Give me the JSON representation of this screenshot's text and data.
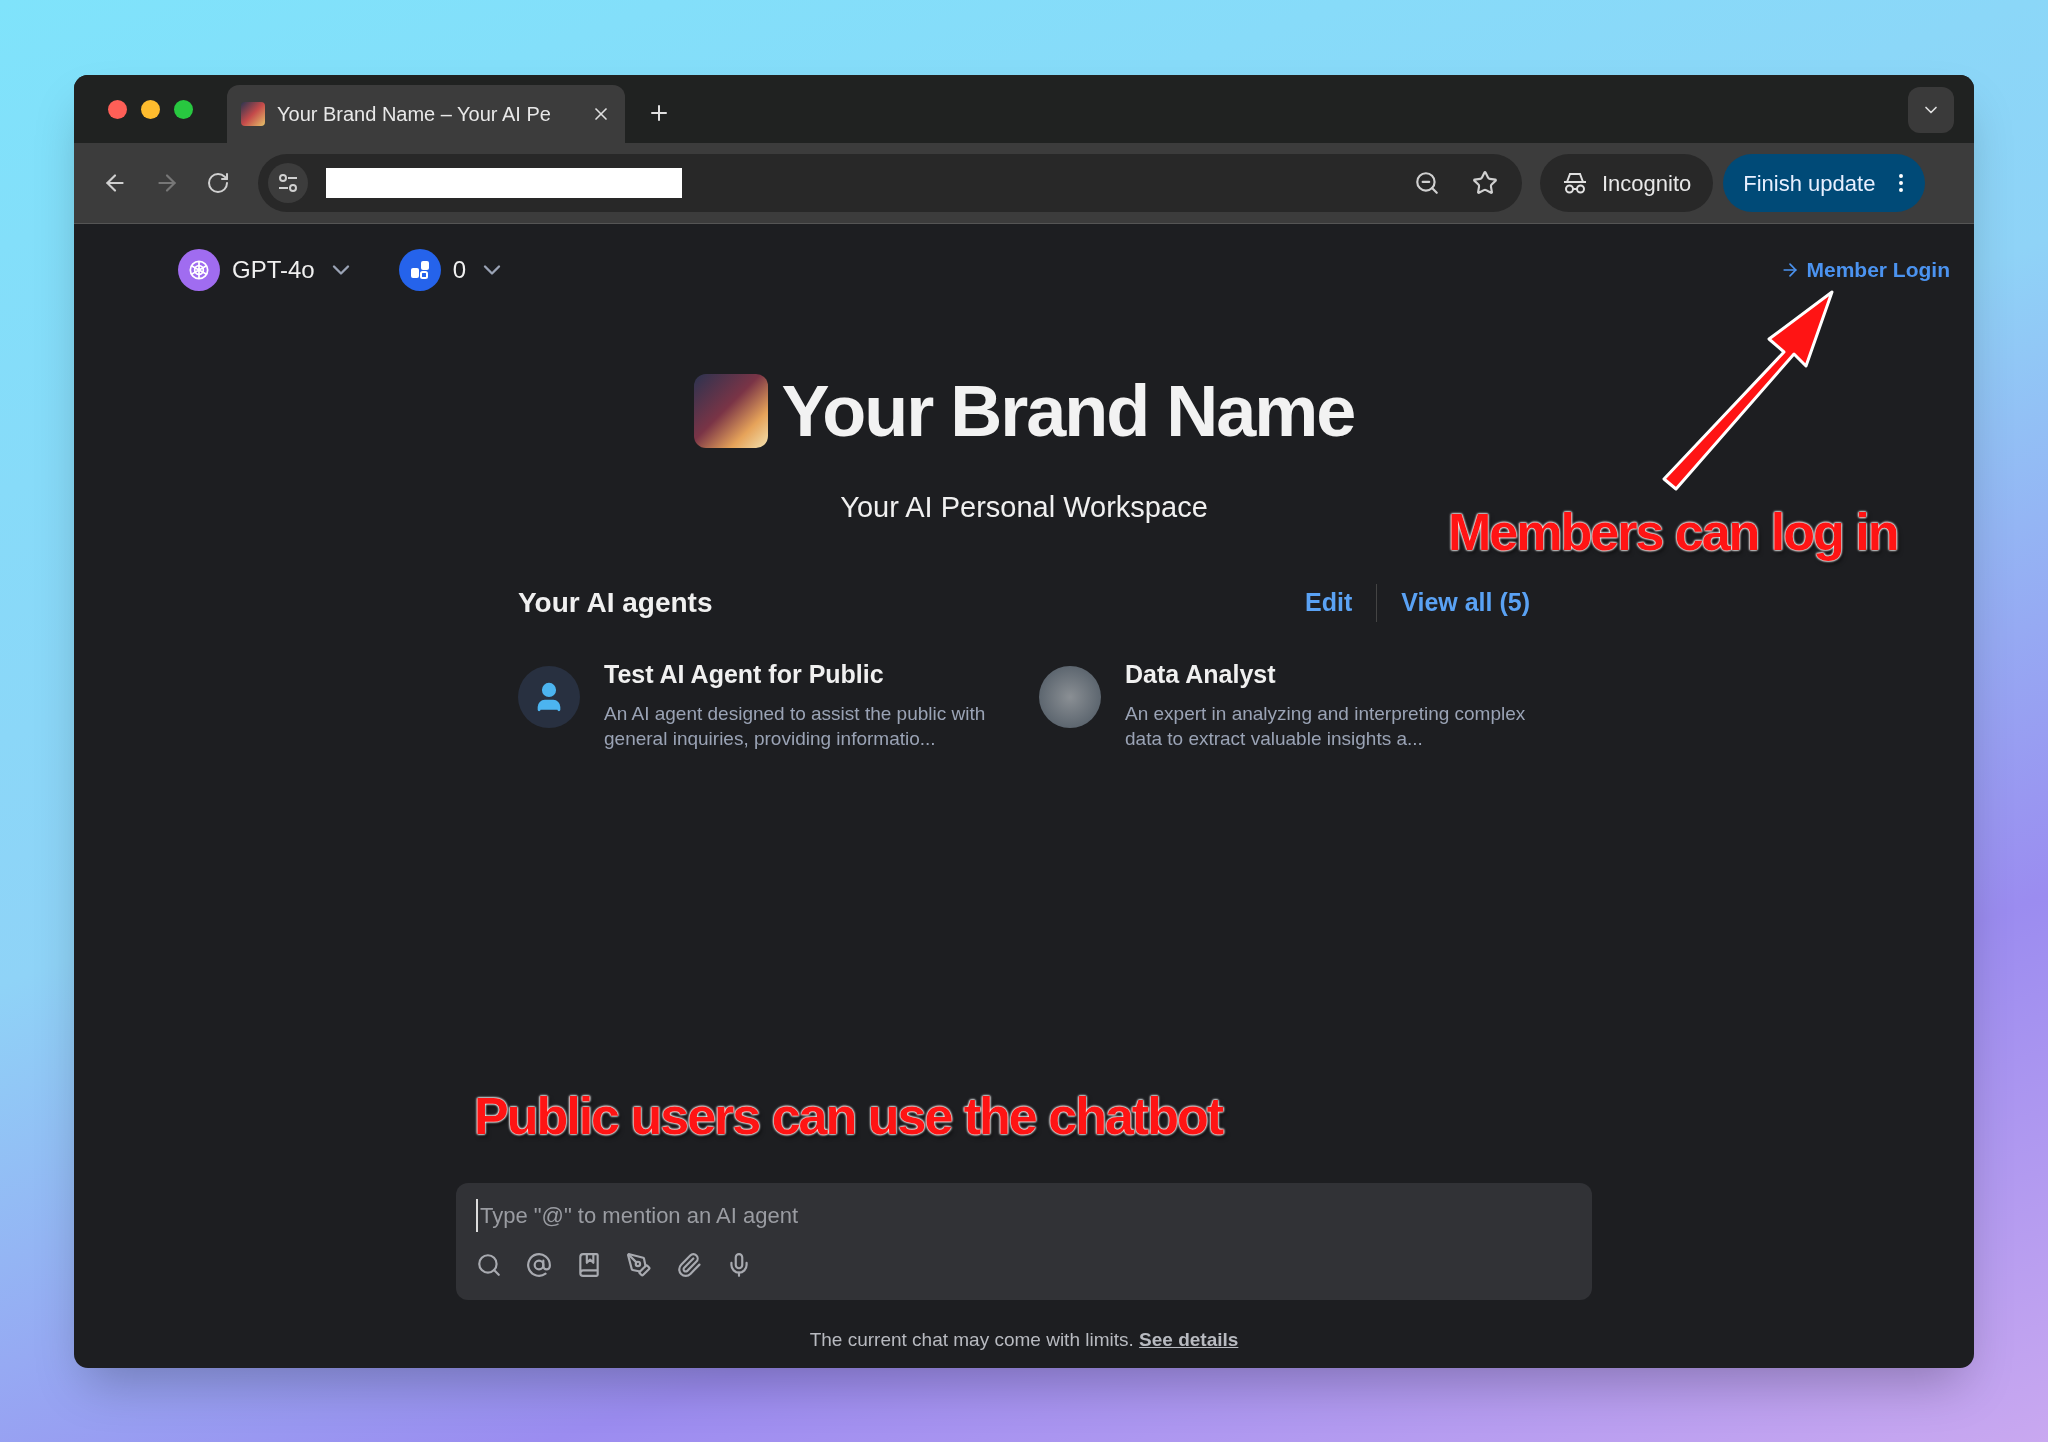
{
  "browser": {
    "tab": {
      "title": "Your Brand Name – Your AI Pe",
      "selected": true
    },
    "toolbar": {
      "incognito": "Incognito",
      "update_button": "Finish update"
    }
  },
  "header": {
    "model": "GPT-4o",
    "count": "0",
    "login": "Member Login"
  },
  "hero": {
    "title": "Your Brand Name",
    "subtitle": "Your AI Personal Workspace"
  },
  "agents": {
    "heading": "Your AI agents",
    "edit": "Edit",
    "view_all": "View all (5)",
    "items": [
      {
        "kind": "icon",
        "name": "Test AI Agent for Public",
        "description": "An AI agent designed to assist the public with general inquiries, providing informatio..."
      },
      {
        "kind": "photo",
        "name": "Data Analyst",
        "description": "An expert in analyzing and interpreting complex data to extract valuable insights a..."
      }
    ]
  },
  "composer": {
    "placeholder": "Type \"@\" to mention an AI agent"
  },
  "footer": {
    "text": "The current chat may come with limits.",
    "link": "See details"
  },
  "annotations": [
    {
      "kind": "login",
      "text": "Members can log in"
    },
    {
      "kind": "chat",
      "text": "Public users can use the chatbot"
    }
  ]
}
